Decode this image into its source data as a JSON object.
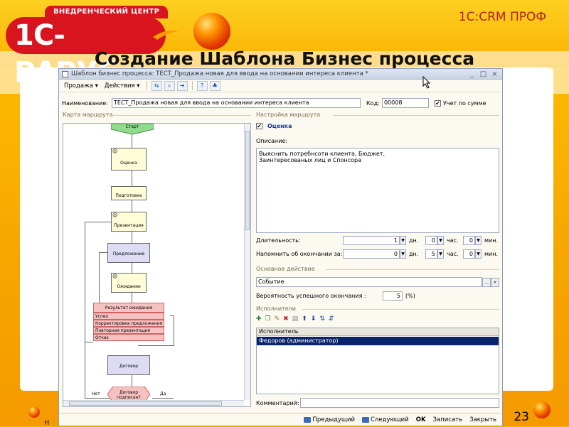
{
  "slide": {
    "logo_tagline": "ВНЕДРЕНЧЕСКИЙ ЦЕНТР",
    "logo_name": "1С-РАРУС",
    "brand": "1С:CRM ПРОФ",
    "title": "Создание Шаблона Бизнес процесса",
    "page_number": "23",
    "bottom_left_fragment": "Н"
  },
  "window": {
    "title": "Шаблон бизнес процесса: ТЕСТ_Продажа новая для ввода на основании интереса клиента *",
    "controls": [
      "_",
      "□",
      "×"
    ],
    "menu": [
      "Продажа ▾",
      "Действия ▾"
    ],
    "name_label": "Наименование:",
    "name_value": "ТЕСТ_Продажа новая для ввода на основании интереса клиента",
    "code_label": "Код:",
    "code_value": "00008",
    "sum_checkbox_label": "Учет по сумме"
  },
  "map": {
    "label": "Карта маршрута",
    "nodes": {
      "start": "Старт",
      "assessment": "Оценка",
      "preparation": "Подготовка",
      "presentation": "Презентация",
      "proposal": "Предложение",
      "waiting": "Ожидание",
      "result_header": "Результат ожидания",
      "result_rows": [
        "Успех",
        "Корректировка предложения",
        "Повторная презентация",
        "Отказ"
      ],
      "contract": "Договор",
      "contract_check": "Договор подписан?",
      "no_label": "Нет",
      "yes_label": "Да"
    }
  },
  "settings": {
    "label": "Настройка маршрута",
    "step_name": "Оценка",
    "description_label": "Описание:",
    "description_lines": [
      "Выяснить потребнсоти клиента, Бюджет,",
      "Заинтересованых лиц и Спонсора"
    ],
    "duration_label": "Длительность:",
    "duration": {
      "days": "1",
      "days_unit": "дн.",
      "hours": "0",
      "hours_unit": "час.",
      "minutes": "0",
      "minutes_unit": "мин."
    },
    "remind_label": "Напомнить об окончании за:",
    "remind": {
      "days": "0",
      "days_unit": "дн.",
      "hours": "5",
      "hours_unit": "час.",
      "minutes": "0",
      "minutes_unit": "мин."
    },
    "main_action_label": "Основное действие",
    "main_action_value": "Событие",
    "main_action_buttons": [
      "...",
      "×"
    ],
    "probability_label": "Вероятность успешного окончания :",
    "probability_value": "5",
    "probability_unit": "(%)",
    "executors_label": "Исполнители",
    "executors_header": "Исполнитель",
    "executors": [
      "Федоров (администратор)"
    ],
    "comment_label": "Комментарий:"
  },
  "statusbar": {
    "prev": "Предыдущий",
    "next": "Следующий",
    "ok": "OK",
    "save": "Записать",
    "close": "Закрыть"
  }
}
